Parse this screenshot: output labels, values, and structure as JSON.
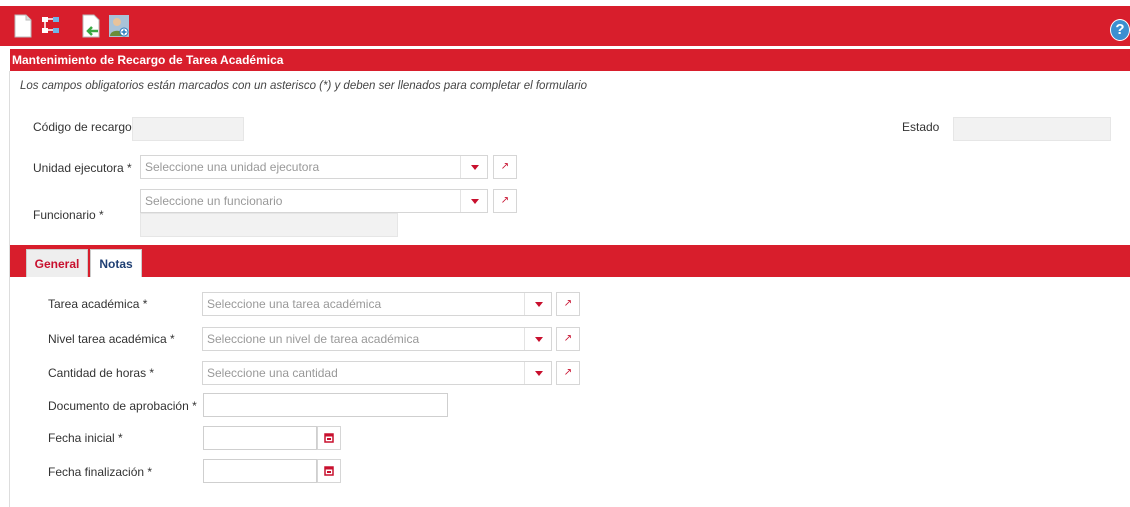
{
  "toolbar": {
    "icons": [
      "new-document-icon",
      "hierarchy-icon",
      "export-document-icon",
      "add-user-icon"
    ],
    "help_label": "?"
  },
  "form": {
    "title": "Mantenimiento de Recargo de Tarea Académica",
    "required_note": "Los campos obligatorios están marcados con un asterisco (*) y deben ser llenados para completar el formulario",
    "codigo_label": "Código de recargo",
    "estado_label": "Estado",
    "unidad_label": "Unidad ejecutora *",
    "unidad_placeholder": "Seleccione una unidad ejecutora",
    "funcionario_label": "Funcionario *",
    "funcionario_placeholder": "Seleccione un funcionario"
  },
  "tabs": [
    {
      "label": "General"
    },
    {
      "label": "Notas"
    }
  ],
  "general": {
    "tarea_label": "Tarea académica *",
    "tarea_placeholder": "Seleccione una tarea académica",
    "nivel_label": "Nivel tarea académica *",
    "nivel_placeholder": "Seleccione un nivel de tarea académica",
    "horas_label": "Cantidad de horas *",
    "horas_placeholder": "Seleccione una cantidad",
    "documento_label": "Documento de aprobación *",
    "fecha_inicial_label": "Fecha inicial *",
    "fecha_final_label": "Fecha finalización *"
  },
  "colors": {
    "accent": "#d81e2c",
    "link": "#1f3f73"
  }
}
